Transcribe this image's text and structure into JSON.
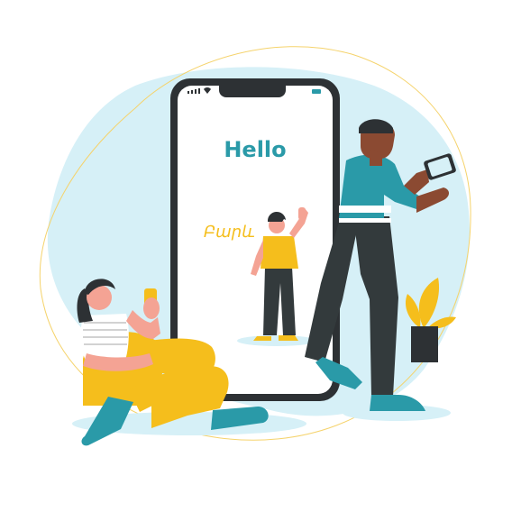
{
  "illustration": {
    "hello_text": "Hello",
    "armenian_text": "Բարև"
  },
  "colors": {
    "teal": "#2a9aa8",
    "yellow": "#f5be1c",
    "blob": "#d5f0f7",
    "phone_frame": "#2d3134",
    "dark_clothes": "#333a3c",
    "skin_light": "#f4a394",
    "skin_dark": "#8b4a32"
  },
  "icons": [
    "signal-icon",
    "battery-icon",
    "plant-icon"
  ]
}
